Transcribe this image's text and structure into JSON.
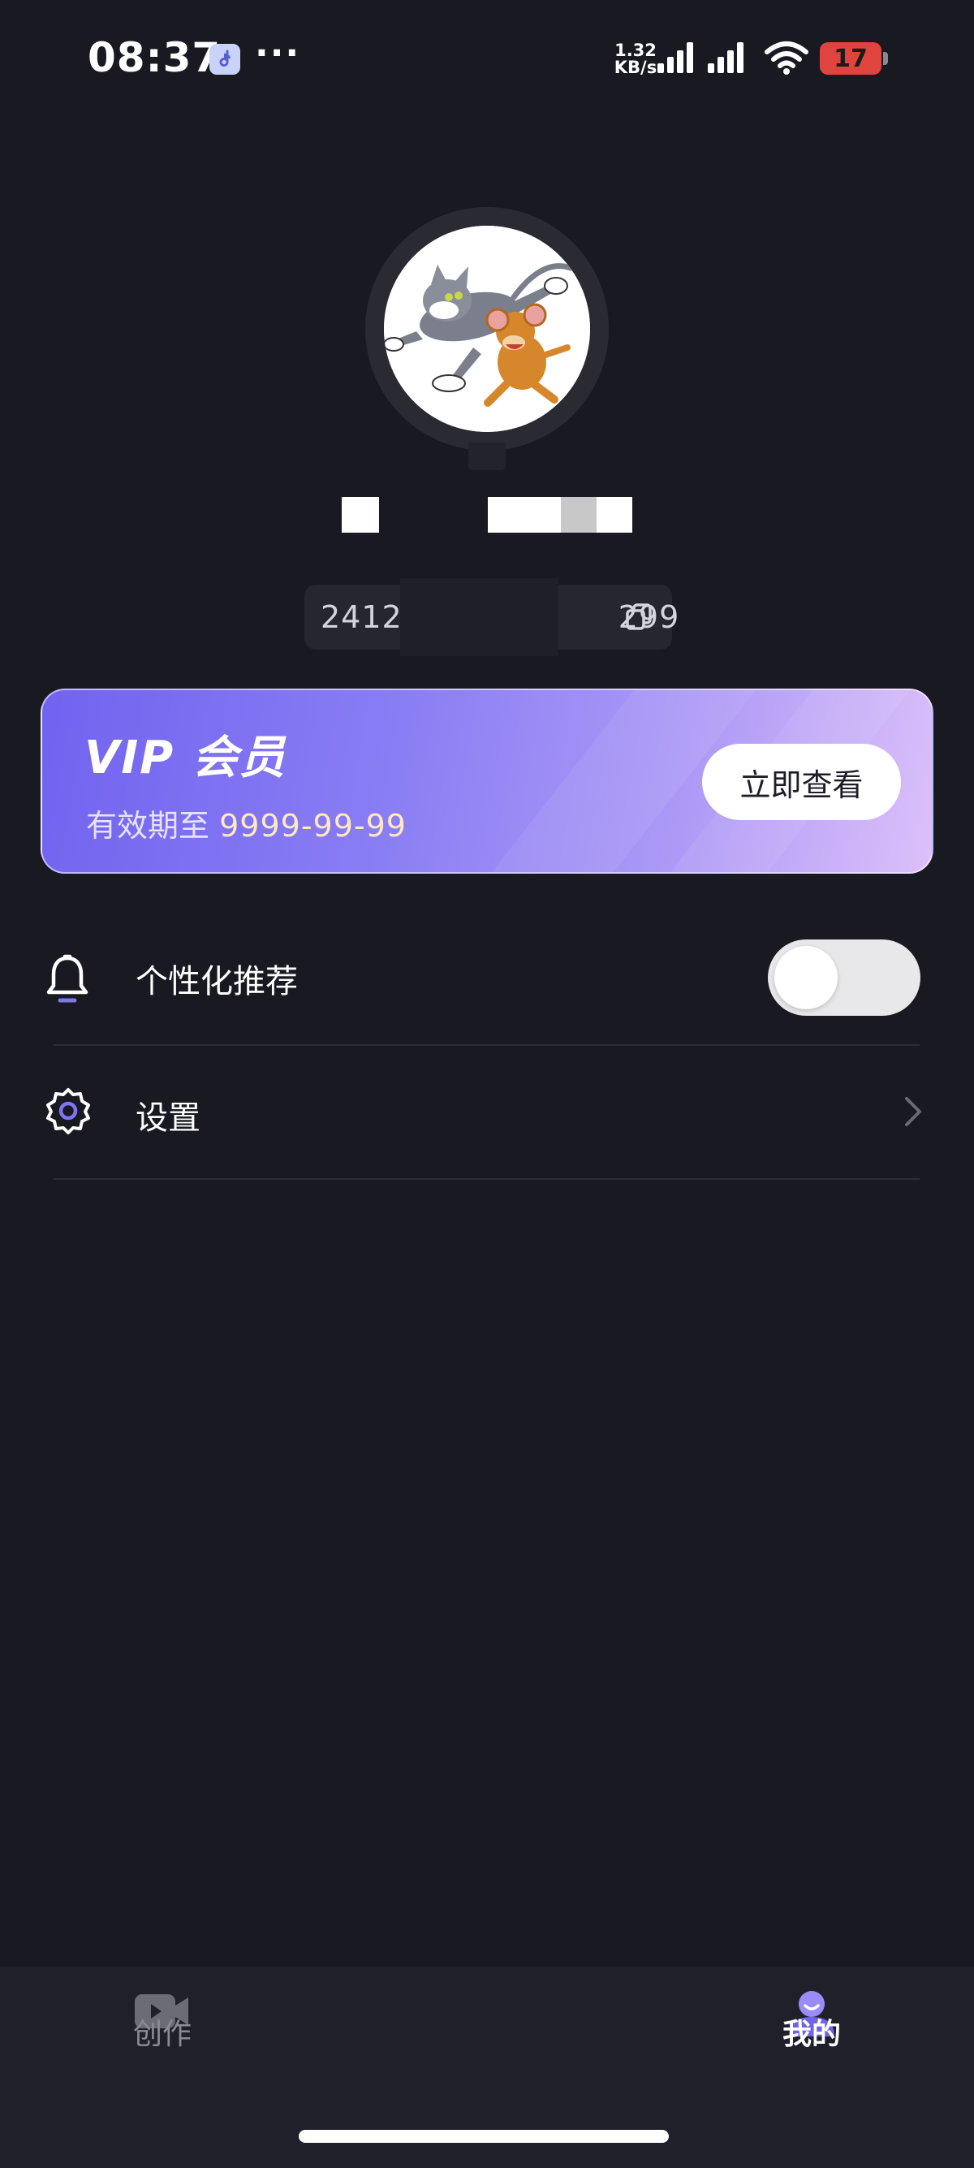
{
  "status_bar": {
    "time": "08:37",
    "more": "···",
    "net_speed_value": "1.32",
    "net_speed_unit": "KB/s",
    "battery_level": "17",
    "icons": [
      "music-note-icon",
      "signal-icon",
      "wifi-icon",
      "battery-icon"
    ]
  },
  "profile": {
    "user_id_start": "2412",
    "user_id_end": "299"
  },
  "vip": {
    "title": "VIP 会员",
    "expiry_label": "有效期至",
    "expiry_date": "9999-99-99",
    "button_label": "立即查看"
  },
  "menu": {
    "items": [
      {
        "label": "个性化推荐",
        "icon": "bell-icon",
        "control": "toggle",
        "enabled": false
      },
      {
        "label": "设置",
        "icon": "gear-icon",
        "control": "chevron"
      }
    ]
  },
  "bottom_nav": {
    "tabs": [
      {
        "label": "创作",
        "icon": "video-camera-icon",
        "active": false
      },
      {
        "label": "我的",
        "icon": "user-icon",
        "active": true
      }
    ]
  },
  "colors": {
    "background": "#191922",
    "vip_gradient_start": "#7263ef",
    "vip_gradient_end": "#dcc0fa",
    "nav_background": "#20202b",
    "active_accent": "#8b7cf4"
  }
}
